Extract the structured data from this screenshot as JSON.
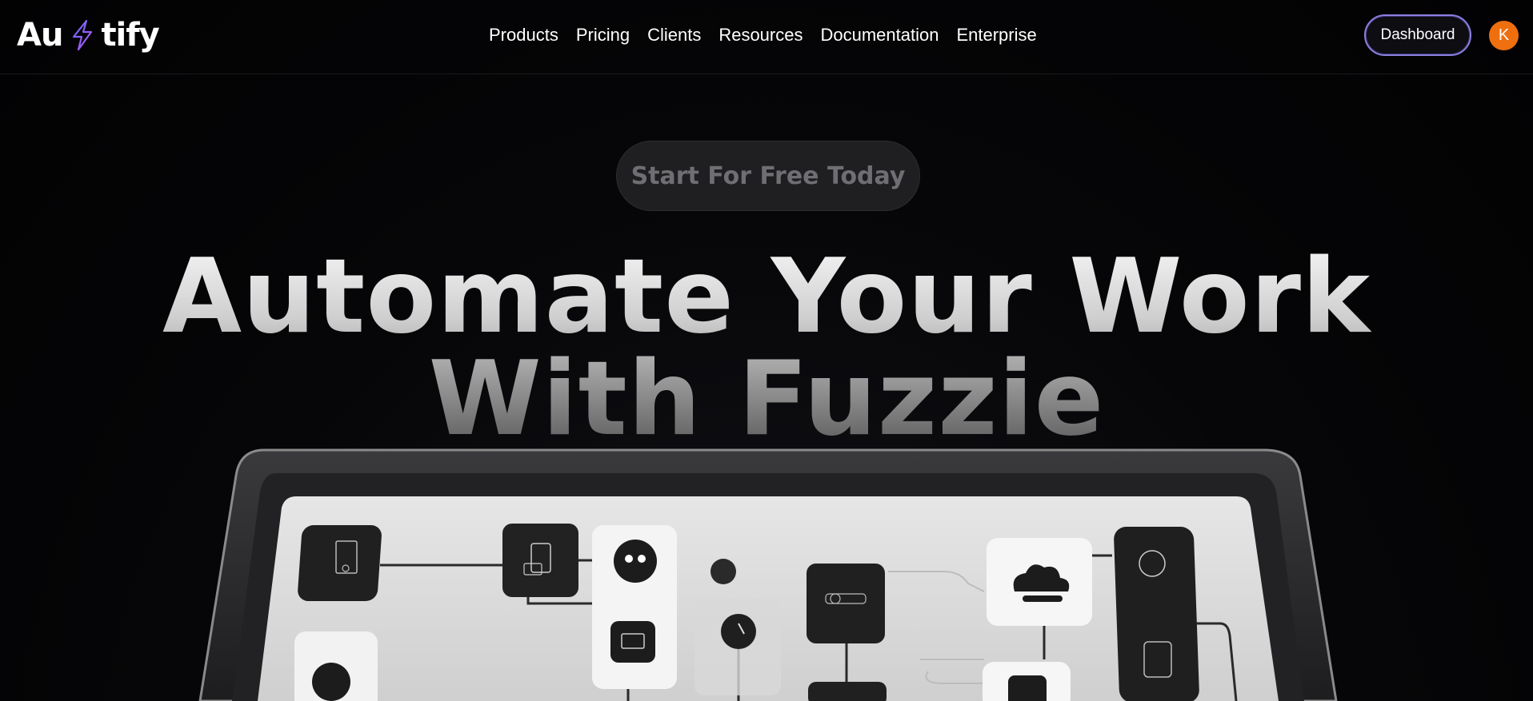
{
  "nav": {
    "logo_left": "Au",
    "logo_right": "tify",
    "links": [
      "Products",
      "Pricing",
      "Clients",
      "Resources",
      "Documentation",
      "Enterprise"
    ],
    "dashboard_label": "Dashboard",
    "avatar_initial": "K"
  },
  "hero": {
    "cta_label": "Start For Free Today",
    "headline_line1": "Automate Your Work",
    "headline_line2": "With Fuzzie"
  },
  "colors": {
    "accent_purple": "#8b7fe0",
    "avatar_orange": "#ef6f0f",
    "background": "#060608"
  },
  "icons": [
    "lightning-bolt-icon"
  ]
}
